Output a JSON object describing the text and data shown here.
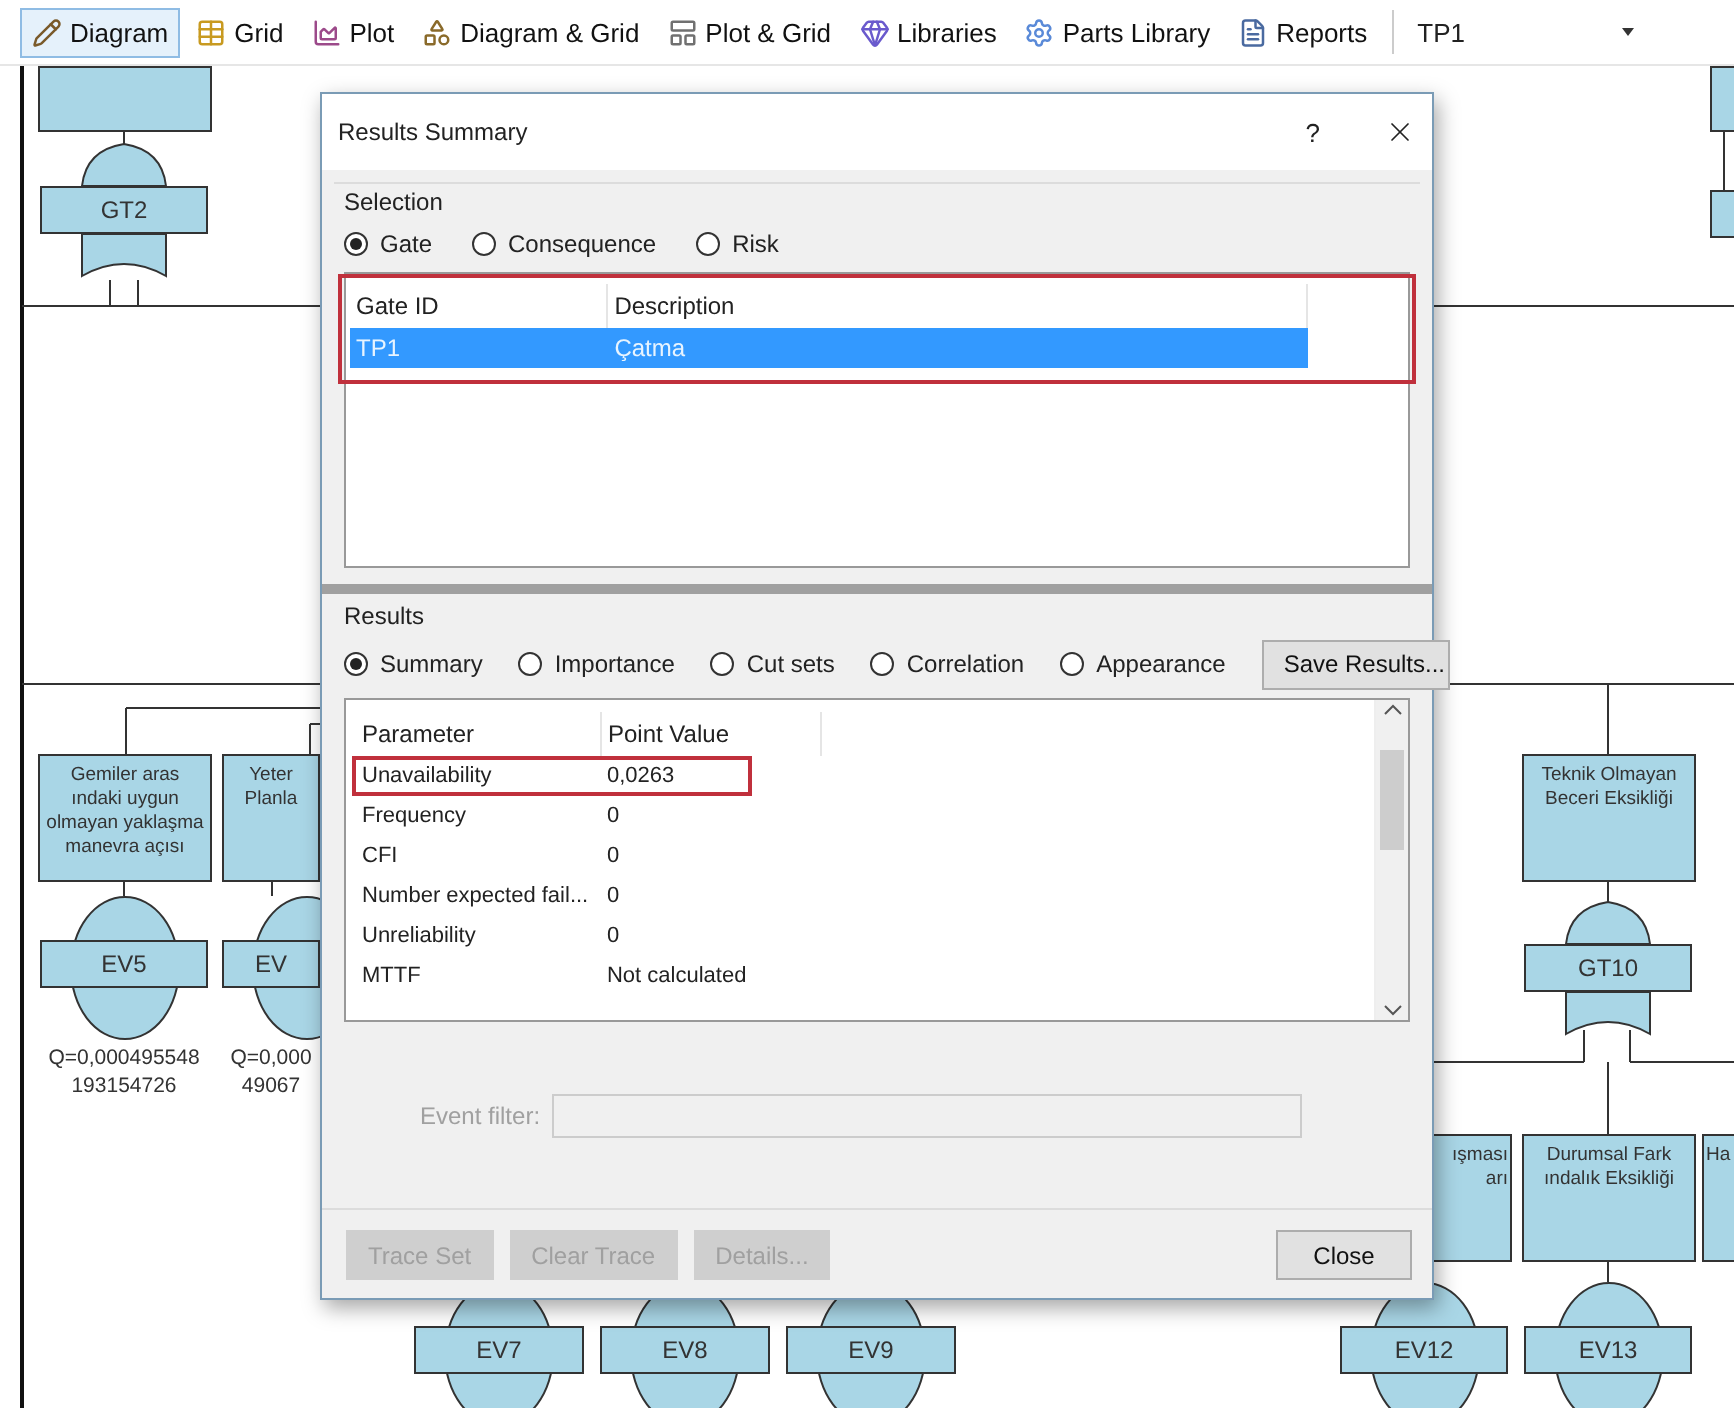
{
  "toolbar": {
    "items": [
      {
        "label": "Diagram",
        "selected": true
      },
      {
        "label": "Grid",
        "selected": false
      },
      {
        "label": "Plot",
        "selected": false
      },
      {
        "label": "Diagram & Grid",
        "selected": false
      },
      {
        "label": "Plot & Grid",
        "selected": false
      },
      {
        "label": "Libraries",
        "selected": false
      },
      {
        "label": "Parts Library",
        "selected": false
      },
      {
        "label": "Reports",
        "selected": false
      }
    ],
    "gate_selector": {
      "value": "TP1"
    }
  },
  "diagram": {
    "descriptions": [
      {
        "lines": [
          "Gemiler aras",
          "ındaki uygun",
          "olmayan yaklaşma",
          "manevra açısı"
        ]
      },
      {
        "lines": [
          "Yeter",
          "Planla"
        ]
      },
      {
        "lines": [
          "Teknik Olmayan",
          "Beceri Eksikliği"
        ]
      },
      {
        "lines": [
          "ışması",
          "arı"
        ]
      },
      {
        "lines": [
          "Durumsal Fark",
          "ındalık Eksikliği"
        ]
      },
      {
        "lines": [
          "Ha"
        ]
      }
    ],
    "gates": [
      {
        "label": "GT2"
      },
      {
        "label": "GT10"
      }
    ],
    "events": [
      {
        "label": "EV5",
        "probability": [
          "Q=0,000495548",
          "193154726"
        ]
      },
      {
        "label": "EV",
        "probability": [
          "Q=0,000",
          "49067"
        ]
      },
      {
        "label": "EV7"
      },
      {
        "label": "EV8"
      },
      {
        "label": "EV9"
      },
      {
        "label": "EV12"
      },
      {
        "label": "EV13"
      }
    ]
  },
  "dialog": {
    "title": "Results Summary",
    "help": "?",
    "selection": {
      "title": "Selection",
      "options": [
        {
          "label": "Gate",
          "selected": true
        },
        {
          "label": "Consequence",
          "selected": false
        },
        {
          "label": "Risk",
          "selected": false
        }
      ],
      "list": {
        "highlighted": true,
        "columns": [
          "Gate ID",
          "Description"
        ],
        "rows": [
          {
            "cells": [
              "TP1",
              "Çatma"
            ],
            "selected": true
          }
        ]
      }
    },
    "results": {
      "title": "Results",
      "options": [
        {
          "label": "Summary",
          "selected": true
        },
        {
          "label": "Importance",
          "selected": false
        },
        {
          "label": "Cut sets",
          "selected": false
        },
        {
          "label": "Correlation",
          "selected": false
        },
        {
          "label": "Appearance",
          "selected": false
        }
      ],
      "save_button": "Save Results...",
      "table": {
        "columns": [
          "Parameter",
          "Point Value"
        ],
        "rows": [
          {
            "cells": [
              "Unavailability",
              "0,0263"
            ],
            "highlighted": true
          },
          {
            "cells": [
              "Frequency",
              "0"
            ],
            "highlighted": false
          },
          {
            "cells": [
              "CFI",
              "0"
            ],
            "highlighted": false
          },
          {
            "cells": [
              "Number expected fail...",
              "0"
            ],
            "highlighted": false
          },
          {
            "cells": [
              "Unreliability",
              "0"
            ],
            "highlighted": false
          },
          {
            "cells": [
              "MTTF",
              "Not calculated"
            ],
            "highlighted": false
          }
        ]
      },
      "event_filter": {
        "label": "Event filter:",
        "disabled": true
      }
    },
    "buttons": [
      {
        "label": "Trace Set",
        "disabled": true
      },
      {
        "label": "Clear Trace",
        "disabled": true
      },
      {
        "label": "Details...",
        "disabled": true
      },
      {
        "label": "Close",
        "disabled": false
      }
    ]
  }
}
